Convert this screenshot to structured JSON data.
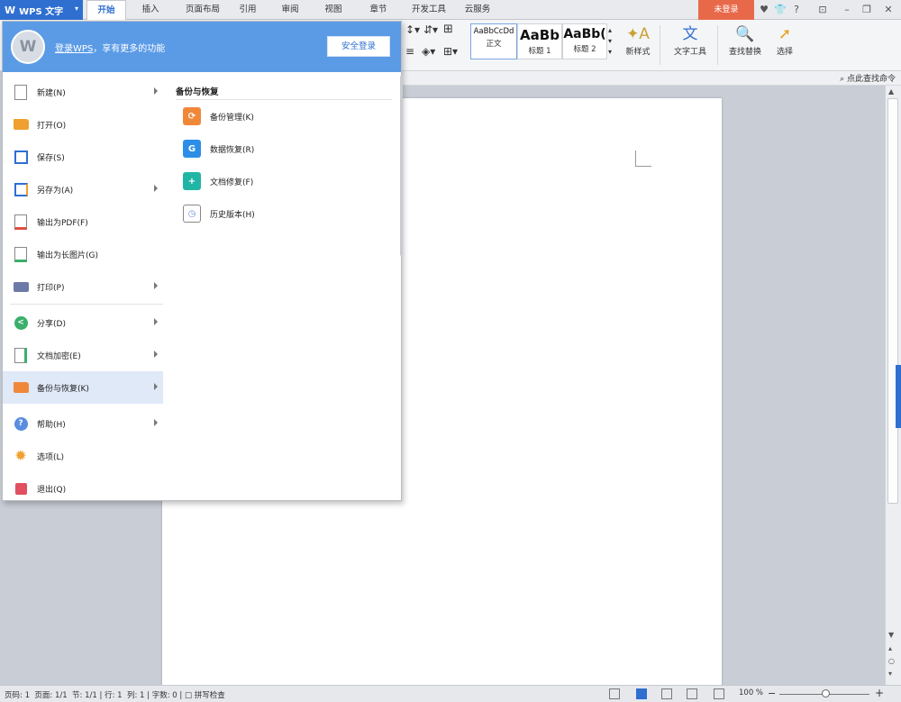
{
  "app": {
    "name": "WPS 文字",
    "logo": "W"
  },
  "tabs": [
    {
      "label": "开始",
      "active": true
    },
    {
      "label": "插入"
    },
    {
      "label": "页面布局"
    },
    {
      "label": "引用"
    },
    {
      "label": "审阅"
    },
    {
      "label": "视图"
    },
    {
      "label": "章节"
    },
    {
      "label": "开发工具"
    },
    {
      "label": "云服务"
    }
  ],
  "top_right": {
    "login_status": "未登录"
  },
  "ribbon": {
    "styles": [
      {
        "sample": "AaBbCcDd",
        "name": "正文"
      },
      {
        "sample": "AaBb",
        "name": "标题 1"
      },
      {
        "sample": "AaBb(",
        "name": "标题 2"
      }
    ],
    "new_style": "新样式",
    "text_tools": "文字工具",
    "find_replace": "查找替换",
    "select": "选择"
  },
  "subbar": {
    "find_command": "点此查找命令"
  },
  "file_menu": {
    "login_link": "登录WPS",
    "login_suffix": "，享有更多的功能",
    "secure_login": "安全登录",
    "items": [
      {
        "label": "新建(N)",
        "icon": "new-doc-icon"
      },
      {
        "label": "打开(O)",
        "icon": "open-folder-icon"
      },
      {
        "label": "保存(S)",
        "icon": "save-icon"
      },
      {
        "label": "另存为(A)",
        "icon": "save-as-icon"
      },
      {
        "label": "输出为PDF(F)",
        "icon": "pdf-icon"
      },
      {
        "label": "输出为长图片(G)",
        "icon": "long-image-icon"
      },
      {
        "label": "打印(P)",
        "icon": "print-icon"
      },
      {
        "label": "分享(D)",
        "icon": "share-icon"
      },
      {
        "label": "文档加密(E)",
        "icon": "encrypt-icon"
      },
      {
        "label": "备份与恢复(K)",
        "icon": "backup-icon"
      },
      {
        "label": "帮助(H)",
        "icon": "help-icon"
      },
      {
        "label": "选项(L)",
        "icon": "options-icon"
      },
      {
        "label": "退出(Q)",
        "icon": "exit-icon"
      }
    ],
    "submenu": {
      "title": "备份与恢复",
      "items": [
        {
          "label": "备份管理(K)",
          "icon": "backup-manage-icon",
          "color": "#f0883a"
        },
        {
          "label": "数据恢复(R)",
          "icon": "data-recovery-icon",
          "color": "#2d8ee8"
        },
        {
          "label": "文档修复(F)",
          "icon": "doc-repair-icon",
          "color": "#21b5a6"
        },
        {
          "label": "历史版本(H)",
          "icon": "history-version-icon",
          "color": "#6b8fd6"
        }
      ]
    }
  },
  "statusbar": {
    "page_num": "页码: 1",
    "pages": "页面: 1/1",
    "section": "节: 1/1",
    "line": "行: 1",
    "column": "列: 1",
    "words": "字数: 0",
    "spellcheck": "拼写检查",
    "zoom": "100 %"
  },
  "colors": {
    "accent": "#2f6fd0",
    "header": "#5b9be6",
    "login": "#e8694a"
  }
}
